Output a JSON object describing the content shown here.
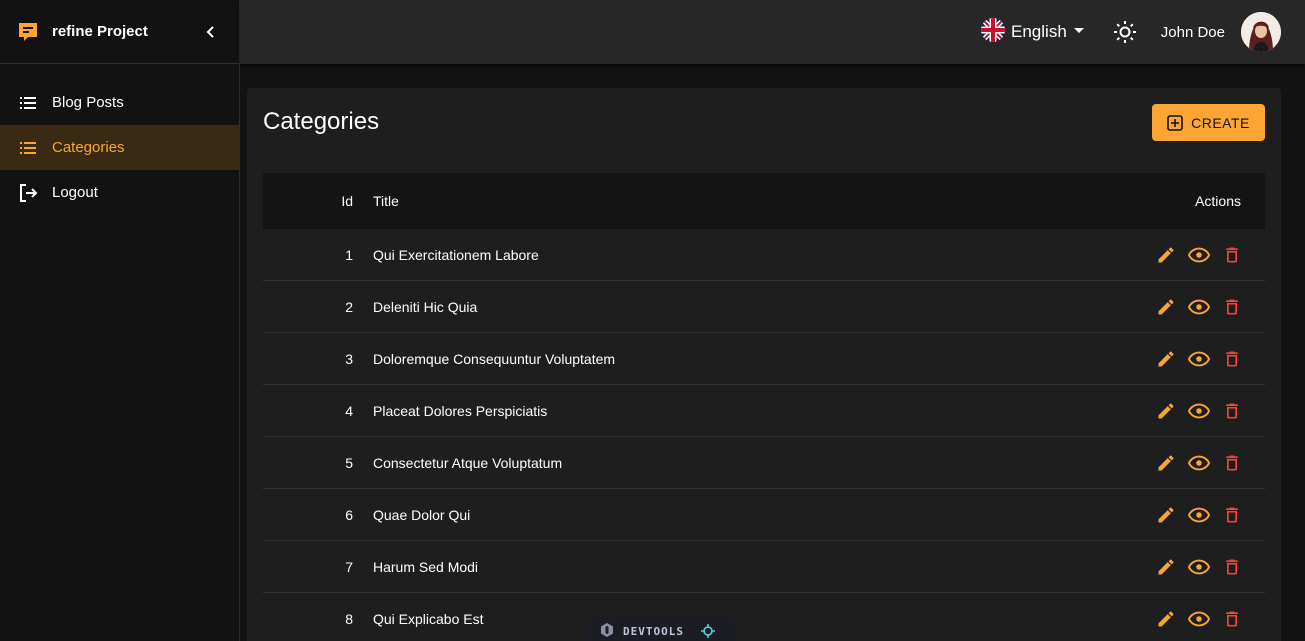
{
  "brand": {
    "title": "refine Project"
  },
  "sidebar": {
    "items": [
      {
        "label": "Blog Posts",
        "icon": "list-icon",
        "active": false
      },
      {
        "label": "Categories",
        "icon": "list-icon",
        "active": true
      },
      {
        "label": "Logout",
        "icon": "logout-icon",
        "active": false
      }
    ]
  },
  "header": {
    "language": "English",
    "user_name": "John Doe"
  },
  "page": {
    "title": "Categories",
    "create_label": "CREATE"
  },
  "table": {
    "columns": {
      "id": "Id",
      "title": "Title",
      "actions": "Actions"
    },
    "rows": [
      {
        "id": "1",
        "title": "Qui Exercitationem Labore"
      },
      {
        "id": "2",
        "title": "Deleniti Hic Quia"
      },
      {
        "id": "3",
        "title": "Doloremque Consequuntur Voluptatem"
      },
      {
        "id": "4",
        "title": "Placeat Dolores Perspiciatis"
      },
      {
        "id": "5",
        "title": "Consectetur Atque Voluptatum"
      },
      {
        "id": "6",
        "title": "Quae Dolor Qui"
      },
      {
        "id": "7",
        "title": "Harum Sed Modi"
      },
      {
        "id": "8",
        "title": "Qui Explicabo Est"
      }
    ]
  },
  "devtools": {
    "label": "DEVTOOLS"
  },
  "colors": {
    "accent": "#fca535",
    "danger": "#f44336",
    "background": "#121212",
    "surface": "#1e1e1e"
  }
}
